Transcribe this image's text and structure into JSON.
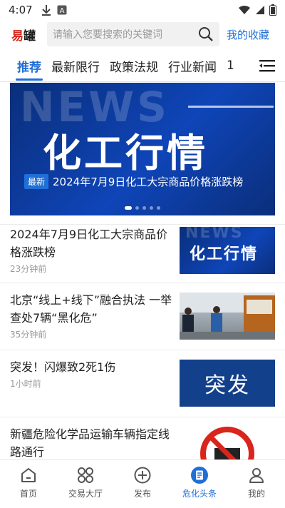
{
  "status_bar": {
    "time": "4:07",
    "left_icons": [
      "download-icon",
      "a-icon"
    ],
    "right_icons": [
      "wifi-icon",
      "signal-icon",
      "battery-icon"
    ]
  },
  "header": {
    "logo_text_a": "易",
    "logo_text_b": "罐",
    "search_placeholder": "请输入您要搜索的关键词",
    "favorites_label": "我的收藏"
  },
  "tabs": [
    {
      "label": "推荐",
      "active": true
    },
    {
      "label": "最新限行",
      "active": false
    },
    {
      "label": "政策法规",
      "active": false
    },
    {
      "label": "行业新闻",
      "active": false
    },
    {
      "label": "1",
      "active": false
    }
  ],
  "banner": {
    "bg_text": "NEWS",
    "headline": "化工行情",
    "tag": "最新",
    "caption": "2024年7月9日化工大宗商品价格涨跌榜",
    "dot_count": 5,
    "active_dot": 0
  },
  "news": [
    {
      "title": "2024年7月9日化工大宗商品价格涨跌榜",
      "time": "23分钟前",
      "thumb_type": "chem",
      "thumb_text": "化工行情"
    },
    {
      "title": "北京“线上+线下”融合执法 一举查处7辆“黑化危”",
      "time": "35分钟前",
      "thumb_type": "photo",
      "thumb_text": ""
    },
    {
      "title": "突发！闪爆致2死1伤",
      "time": "1小时前",
      "thumb_type": "alert",
      "thumb_text": "突发"
    },
    {
      "title": "新疆危险化学品运输车辆指定线路通行",
      "time": "",
      "thumb_type": "sign",
      "thumb_text": ""
    }
  ],
  "bottom_nav": [
    {
      "label": "首页",
      "icon": "home-icon",
      "active": false
    },
    {
      "label": "交易大厅",
      "icon": "grid-icon",
      "active": false
    },
    {
      "label": "发布",
      "icon": "plus-circle-icon",
      "active": false
    },
    {
      "label": "危化头条",
      "icon": "news-doc-icon",
      "active": true
    },
    {
      "label": "我的",
      "icon": "user-icon",
      "active": false
    }
  ],
  "colors": {
    "accent": "#1f6fd6",
    "banner_bg": "#0f45b8",
    "logo_red": "#d9251c"
  }
}
